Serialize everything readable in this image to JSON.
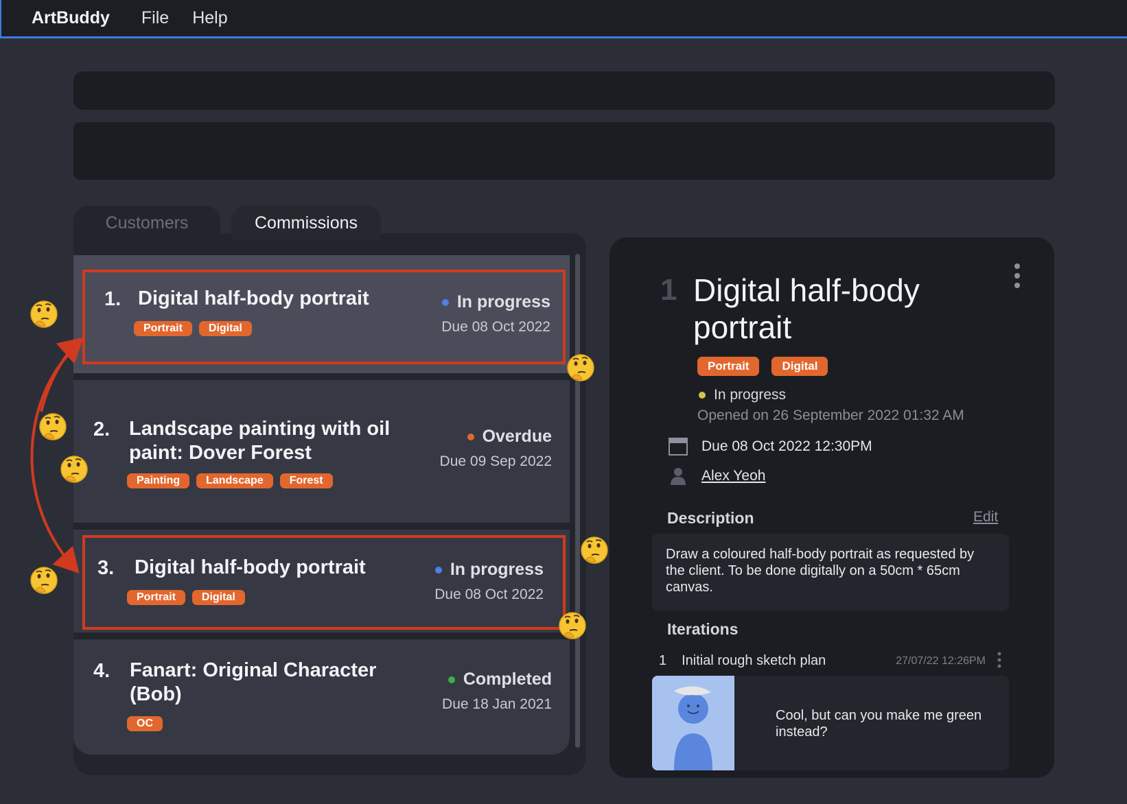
{
  "menubar": {
    "app_name": "ArtBuddy",
    "file": "File",
    "help": "Help",
    "accent_color": "#3b7be0"
  },
  "tabs": [
    {
      "label": "Customers",
      "active": false
    },
    {
      "label": "Commissions",
      "active": true
    }
  ],
  "commissions": [
    {
      "index": "1.",
      "title": "Digital half-body portrait",
      "tags": [
        "Portrait",
        "Digital"
      ],
      "status": "In progress",
      "status_color": "#4f7fe8",
      "due": "Due 08 Oct 2022"
    },
    {
      "index": "2.",
      "title": "Landscape painting with oil paint: Dover Forest",
      "tags": [
        "Painting",
        "Landscape",
        "Forest"
      ],
      "status": "Overdue",
      "status_color": "#e2672e",
      "due": "Due 09 Sep 2022"
    },
    {
      "index": "3.",
      "title": "Digital half-body portrait",
      "tags": [
        "Portrait",
        "Digital"
      ],
      "status": "In progress",
      "status_color": "#4f7fe8",
      "due": "Due 08 Oct 2022"
    },
    {
      "index": "4.",
      "title": "Fanart: Original Character (Bob)",
      "tags": [
        "OC"
      ],
      "status": "Completed",
      "status_color": "#3fae49",
      "due": "Due 18 Jan 2021"
    }
  ],
  "detail": {
    "number": "1",
    "title": "Digital half-body portrait",
    "tags": [
      "Portrait",
      "Digital"
    ],
    "status": "In progress",
    "status_color": "#d8c24a",
    "opened": "Opened on 26 September 2022 01:32 AM",
    "due": "Due 08 Oct 2022 12:30PM",
    "customer": "Alex Yeoh",
    "description_heading": "Description",
    "edit_label": "Edit",
    "description": "Draw a coloured half-body portrait as requested by the client. To be done digitally on a 50cm * 65cm canvas.",
    "iterations_heading": "Iterations",
    "iterations": [
      {
        "number": "1",
        "title": "Initial rough sketch plan",
        "timestamp": "27/07/22 12:26PM",
        "comment": "Cool, but can you make me green instead?"
      }
    ]
  },
  "annotation": {
    "highlight_color": "#d13a1f",
    "emoji_icon": "thinking-face-icon"
  }
}
